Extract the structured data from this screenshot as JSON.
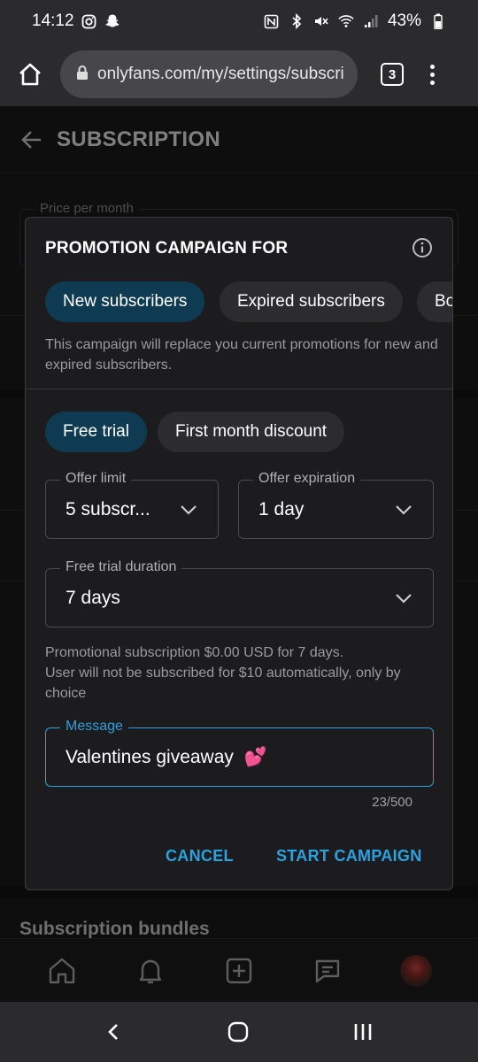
{
  "status_bar": {
    "time": "14:12",
    "battery": "43%"
  },
  "browser": {
    "url": "onlyfans.com/my/settings/subscrip",
    "tab_count": "3"
  },
  "page": {
    "title": "SUBSCRIPTION",
    "price_label": "Price per month",
    "section_bundles": "Subscription bundles"
  },
  "modal": {
    "title": "PROMOTION CAMPAIGN FOR",
    "audience_tabs": [
      {
        "label": "New subscribers",
        "active": true
      },
      {
        "label": "Expired subscribers",
        "active": false
      },
      {
        "label": "Bo",
        "active": false
      }
    ],
    "note": "This campaign will replace you current promotions for new and expired subscribers.",
    "type_tabs": [
      {
        "label": "Free trial",
        "active": true
      },
      {
        "label": "First month discount",
        "active": false
      }
    ],
    "offer_limit": {
      "label": "Offer limit",
      "value": "5 subscr..."
    },
    "offer_expiration": {
      "label": "Offer expiration",
      "value": "1 day"
    },
    "trial_duration": {
      "label": "Free trial duration",
      "value": "7 days"
    },
    "promo_line1": "Promotional subscription $0.00 USD for 7 days.",
    "promo_line2": "User will not be subscribed for $10 automatically, only by choice",
    "message": {
      "label": "Message",
      "value": "Valentines giveaway",
      "emoji": "💕",
      "counter": "23/500"
    },
    "cancel_label": "CANCEL",
    "start_label": "START CAMPAIGN"
  },
  "colors": {
    "accent": "#2aa1e0",
    "active_chip": "#0f3b52",
    "surface": "#1c1c1e"
  }
}
